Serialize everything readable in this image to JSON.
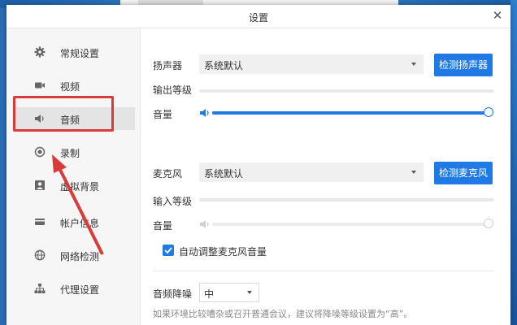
{
  "window": {
    "title": "设置",
    "close_symbol": "✕"
  },
  "sidebar": {
    "items": [
      {
        "label": "常规设置",
        "icon": "gear-icon"
      },
      {
        "label": "视频",
        "icon": "video-camera-icon"
      },
      {
        "label": "音频",
        "icon": "speaker-icon",
        "active": true
      },
      {
        "label": "录制",
        "icon": "record-icon"
      },
      {
        "label": "虚拟背景",
        "icon": "person-icon"
      },
      {
        "label": "帐户信息",
        "icon": "card-icon"
      },
      {
        "label": "网络检测",
        "icon": "globe-icon"
      },
      {
        "label": "代理设置",
        "icon": "network-icon"
      }
    ]
  },
  "speaker": {
    "label": "扬声器",
    "device": "系统默认",
    "test_button": "检测扬声器",
    "output_level_label": "输出等级",
    "output_level": 0,
    "volume_label": "音量",
    "volume": 1.0
  },
  "microphone": {
    "label": "麦克风",
    "device": "系统默认",
    "test_button": "检测麦克风",
    "input_level_label": "输入等级",
    "input_level": 0,
    "volume_label": "音量",
    "volume": 1.0,
    "auto_adjust_label": "自动调整麦克风音量",
    "auto_adjust_checked": true
  },
  "noise": {
    "label": "音频降噪",
    "value": "中",
    "hint": "如果环境比较嘈杂或召开普通会议，建议将降噪等级设置为“高”。"
  },
  "colors": {
    "accent": "#1f7ae6",
    "annotation": "#d93a3a"
  }
}
